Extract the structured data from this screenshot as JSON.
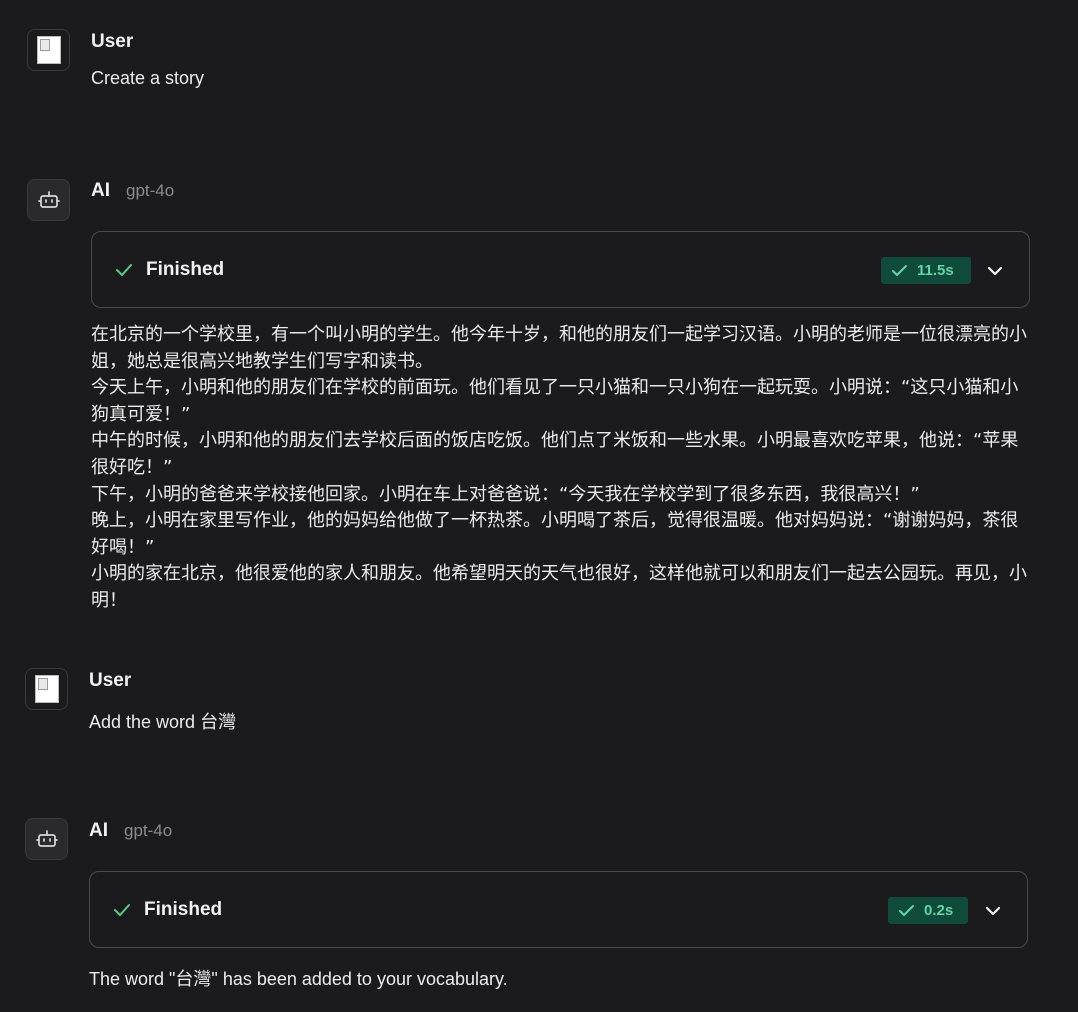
{
  "messages": [
    {
      "role": "User",
      "text": "Create a story"
    },
    {
      "role": "AI",
      "model": "gpt-4o",
      "status": "Finished",
      "duration": "11.5s",
      "paragraphs": [
        "在北京的一个学校里，有一个叫小明的学生。他今年十岁，和他的朋友们一起学习汉语。小明的老师是一位很漂亮的小姐，她总是很高兴地教学生们写字和读书。",
        "今天上午，小明和他的朋友们在学校的前面玩。他们看见了一只小猫和一只小狗在一起玩耍。小明说：“这只小猫和小狗真可爱！”",
        "中午的时候，小明和他的朋友们去学校后面的饭店吃饭。他们点了米饭和一些水果。小明最喜欢吃苹果，他说：“苹果很好吃！”",
        "下午，小明的爸爸来学校接他回家。小明在车上对爸爸说：“今天我在学校学到了很多东西，我很高兴！”",
        "晚上，小明在家里写作业，他的妈妈给他做了一杯热茶。小明喝了茶后，觉得很温暖。他对妈妈说：“谢谢妈妈，茶很好喝！”",
        "小明的家在北京，他很爱他的家人和朋友。他希望明天的天气也很好，这样他就可以和朋友们一起去公园玩。再见，小明！"
      ]
    },
    {
      "role": "User",
      "text": "Add the word 台灣"
    },
    {
      "role": "AI",
      "model": "gpt-4o",
      "status": "Finished",
      "duration": "0.2s",
      "text": "The word \"台灣\" has been added to your vocabulary."
    }
  ],
  "icons": {
    "user_avatar": "broken-image-icon",
    "ai_avatar": "bot-icon",
    "status": "check-icon",
    "expand": "chevron-down-icon"
  },
  "colors": {
    "background": "#1b1b1d",
    "badge_bg": "#0f4b3a",
    "badge_text": "#5fd6a4",
    "check": "#4cd08a"
  }
}
